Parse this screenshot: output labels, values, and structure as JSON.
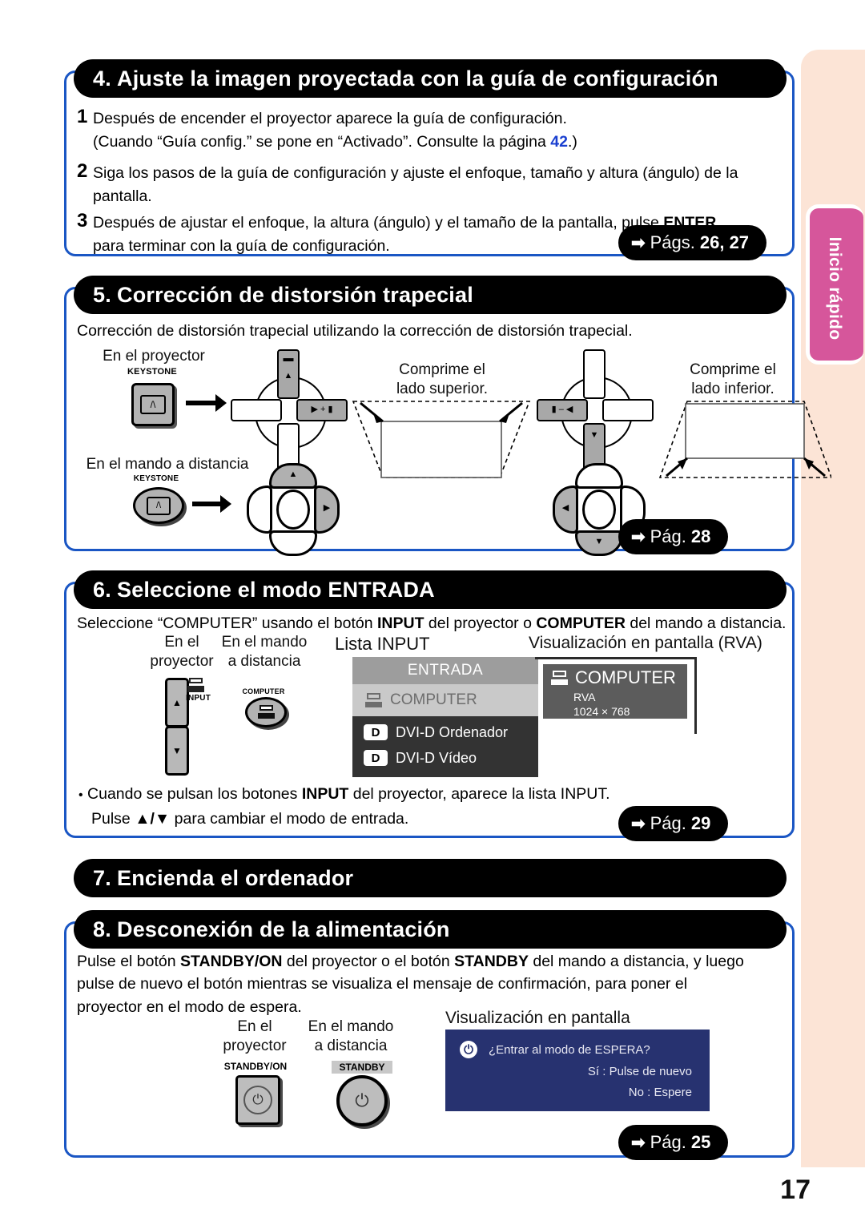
{
  "page_number": "17",
  "side_tab": {
    "label": "Inicio rápido"
  },
  "sections": {
    "s4": {
      "number": "4.",
      "title": "Ajuste la imagen proyectada con la guía de configuración",
      "steps": [
        {
          "num": "1",
          "line1": "Después de encender el proyector aparece la guía de configuración.",
          "line2_a": "(Cuando “Guía config.” se pone en “Activado”. Consulte la página ",
          "line2_ref": "42",
          "line2_b": ".)"
        },
        {
          "num": "2",
          "line1": "Siga los pasos de la guía de configuración y ajuste el enfoque, tamaño y altura (ángulo) de la",
          "line2": "pantalla."
        },
        {
          "num": "3",
          "line1_a": "Después de ajustar el enfoque, la altura (ángulo) y el tamaño de la pantalla, pulse ",
          "line1_b": "ENTER",
          "line2": "para terminar con la guía de configuración."
        }
      ],
      "pageref": {
        "arrow": "➡",
        "label": "Págs. ",
        "value": "26, 27"
      }
    },
    "s5": {
      "number": "5.",
      "title": "Corrección de distorsión trapecial",
      "intro": "Corrección de distorsión trapecial utilizando la corrección de distorsión trapecial.",
      "label_projector": "En el proyector",
      "label_remote": "En el mando a distancia",
      "keystone_label": "KEYSTONE",
      "caption_top": "Comprime el\nlado superior.",
      "caption_top_l1": "Comprime el",
      "caption_top_l2": "lado superior.",
      "caption_bottom_l1": "Comprime el",
      "caption_bottom_l2": "lado inferior.",
      "pageref": {
        "arrow": "➡",
        "label": "Pág. ",
        "value": "28"
      }
    },
    "s6": {
      "number": "6.",
      "title": "Seleccione el modo ENTRADA",
      "intro_a": "Seleccione “COMPUTER” usando el botón ",
      "intro_b": "INPUT",
      "intro_c": " del proyector o ",
      "intro_d": "COMPUTER",
      "intro_e": " del mando a distancia.",
      "label_projector_l1": "En el",
      "label_projector_l2": "proyector",
      "label_remote_l1": "En el mando",
      "label_remote_l2": "a distancia",
      "label_input_list": "Lista INPUT",
      "label_osd": "Visualización en pantalla (RVA)",
      "btn_input_label": "INPUT",
      "btn_computer_label": "COMPUTER",
      "input_list": {
        "header": "ENTRADA",
        "selected": "COMPUTER",
        "rows": [
          {
            "badge": "D",
            "label": "DVI-D Ordenador"
          },
          {
            "badge": "D",
            "label": "DVI-D Vídeo"
          }
        ]
      },
      "osd": {
        "title": "COMPUTER",
        "sub1": "RVA",
        "sub2": "1024 × 768"
      },
      "note_a": "Cuando se pulsan los botones ",
      "note_b": "INPUT",
      "note_c": " del proyector, aparece la lista INPUT.",
      "note2_a": "Pulse ",
      "note2_b": "▲/▼",
      "note2_c": " para cambiar el modo de entrada.",
      "pageref": {
        "arrow": "➡",
        "label": "Pág. ",
        "value": "29"
      }
    },
    "s7": {
      "number": "7.",
      "title": "Encienda el ordenador"
    },
    "s8": {
      "number": "8.",
      "title": "Desconexión de la alimentación",
      "body_l1_a": "Pulse el botón ",
      "body_l1_b": "STANDBY/ON",
      "body_l1_c": " del proyector o el botón ",
      "body_l1_d": "STANDBY",
      "body_l1_e": " del mando a distancia, y luego",
      "body_l2": "pulse de nuevo el botón mientras se visualiza el mensaje de confirmación, para poner el",
      "body_l3": "proyector en el modo de espera.",
      "label_projector_l1": "En el",
      "label_projector_l2": "proyector",
      "label_remote_l1": "En el mando",
      "label_remote_l2": "a distancia",
      "btn_standbyon_label": "STANDBY/ON",
      "btn_standby_label": "STANDBY",
      "label_osd": "Visualización en pantalla",
      "osd": {
        "question": "¿Entrar al modo de ESPERA?",
        "yes": "Sí : Pulse de nuevo",
        "no": "No : Espere"
      },
      "pageref": {
        "arrow": "➡",
        "label": "Pág. ",
        "value": "25"
      }
    }
  },
  "colors": {
    "panel_border": "#1a56c4",
    "tab_pink": "#d6569b",
    "strip_peach": "#fce4d6",
    "pill_black": "#000000",
    "blue_ref": "#1a3fd0"
  }
}
